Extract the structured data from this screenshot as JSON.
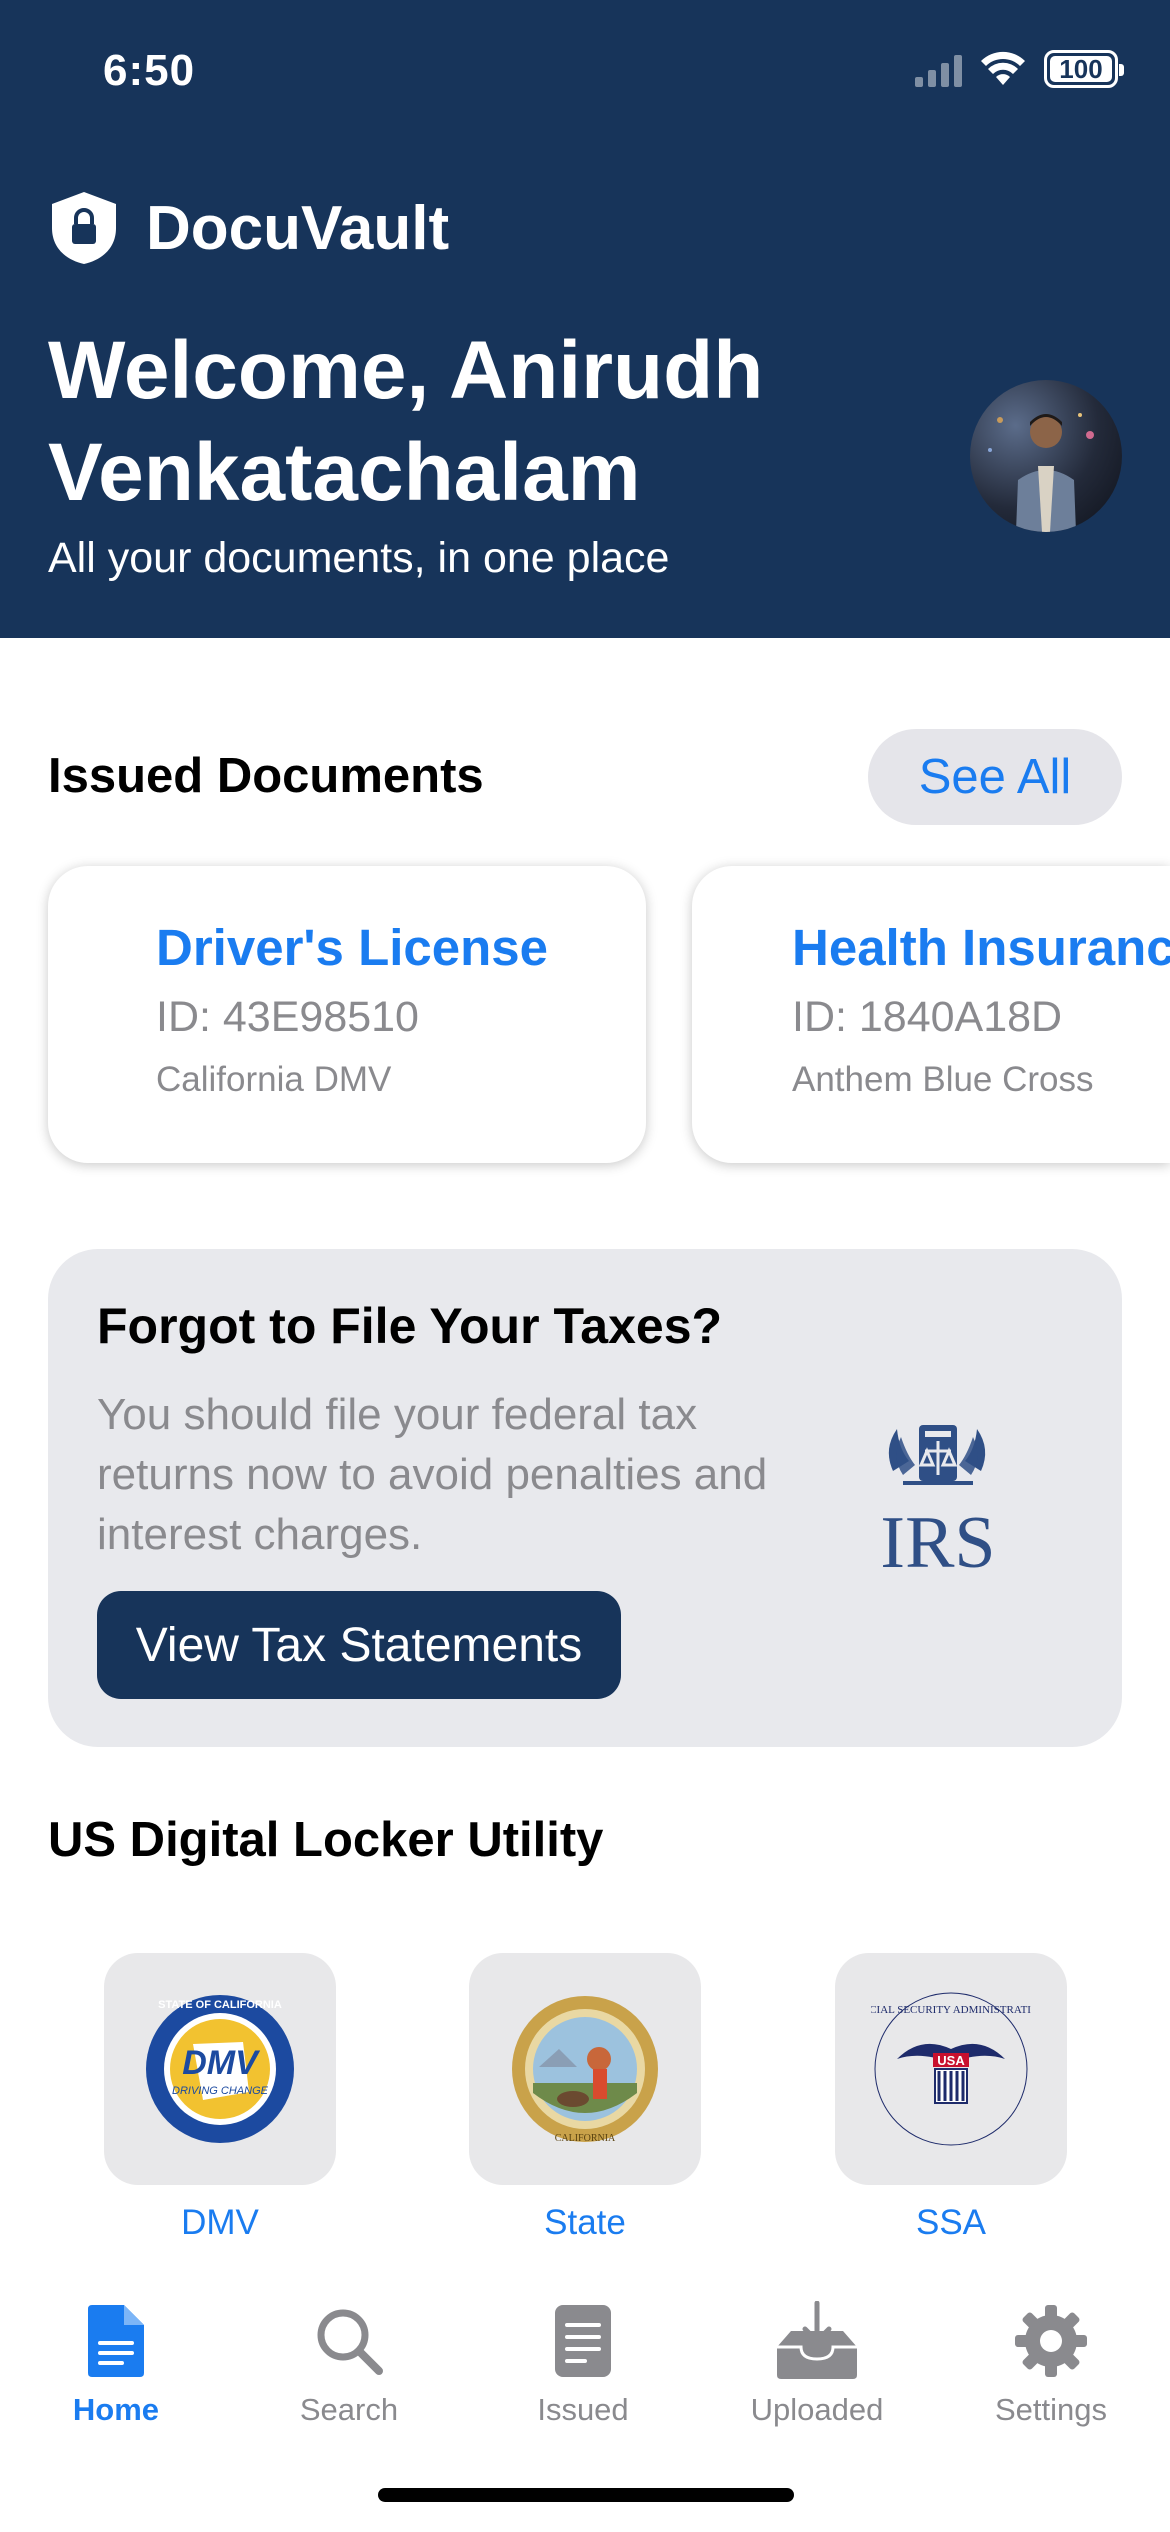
{
  "status_bar": {
    "time": "6:50",
    "battery": "100"
  },
  "header": {
    "app_name": "DocuVault",
    "welcome": "Welcome, Anirudh Venkatachalam",
    "subtitle": "All your documents, in one place"
  },
  "issued_documents": {
    "title": "Issued Documents",
    "see_all_label": "See All",
    "cards": [
      {
        "title": "Driver's License",
        "id": "ID: 43E98510",
        "issuer": "California DMV"
      },
      {
        "title": "Health Insurance",
        "id": "ID: 1840A18D",
        "issuer": "Anthem Blue Cross"
      }
    ]
  },
  "tax_banner": {
    "title": "Forgot to File Your Taxes?",
    "body": "You should file your federal tax returns now to avoid penalties and interest charges.",
    "button_label": "View Tax Statements",
    "logo_text": "IRS"
  },
  "utility": {
    "title": "US Digital Locker Utility",
    "items": [
      {
        "label": "DMV",
        "icon": "dmv-seal-icon",
        "seal_text": "DMV",
        "seal_ring": "STATE OF CALIFORNIA",
        "seal_sub": "DRIVING CHANGE"
      },
      {
        "label": "State",
        "icon": "california-seal-icon",
        "seal_ring": "CALIFORNIA"
      },
      {
        "label": "SSA",
        "icon": "ssa-seal-icon",
        "seal_ring": "SOCIAL SECURITY ADMINISTRATION",
        "seal_text": "USA"
      }
    ]
  },
  "tabbar": {
    "tabs": [
      {
        "label": "Home",
        "icon": "document-icon",
        "active": true
      },
      {
        "label": "Search",
        "icon": "search-icon",
        "active": false
      },
      {
        "label": "Issued",
        "icon": "issued-doc-icon",
        "active": false
      },
      {
        "label": "Uploaded",
        "icon": "tray-download-icon",
        "active": false
      },
      {
        "label": "Settings",
        "icon": "gear-icon",
        "active": false
      }
    ]
  },
  "colors": {
    "header_bg": "#17345a",
    "accent": "#1a7cf0",
    "muted": "#8a8a8e"
  }
}
